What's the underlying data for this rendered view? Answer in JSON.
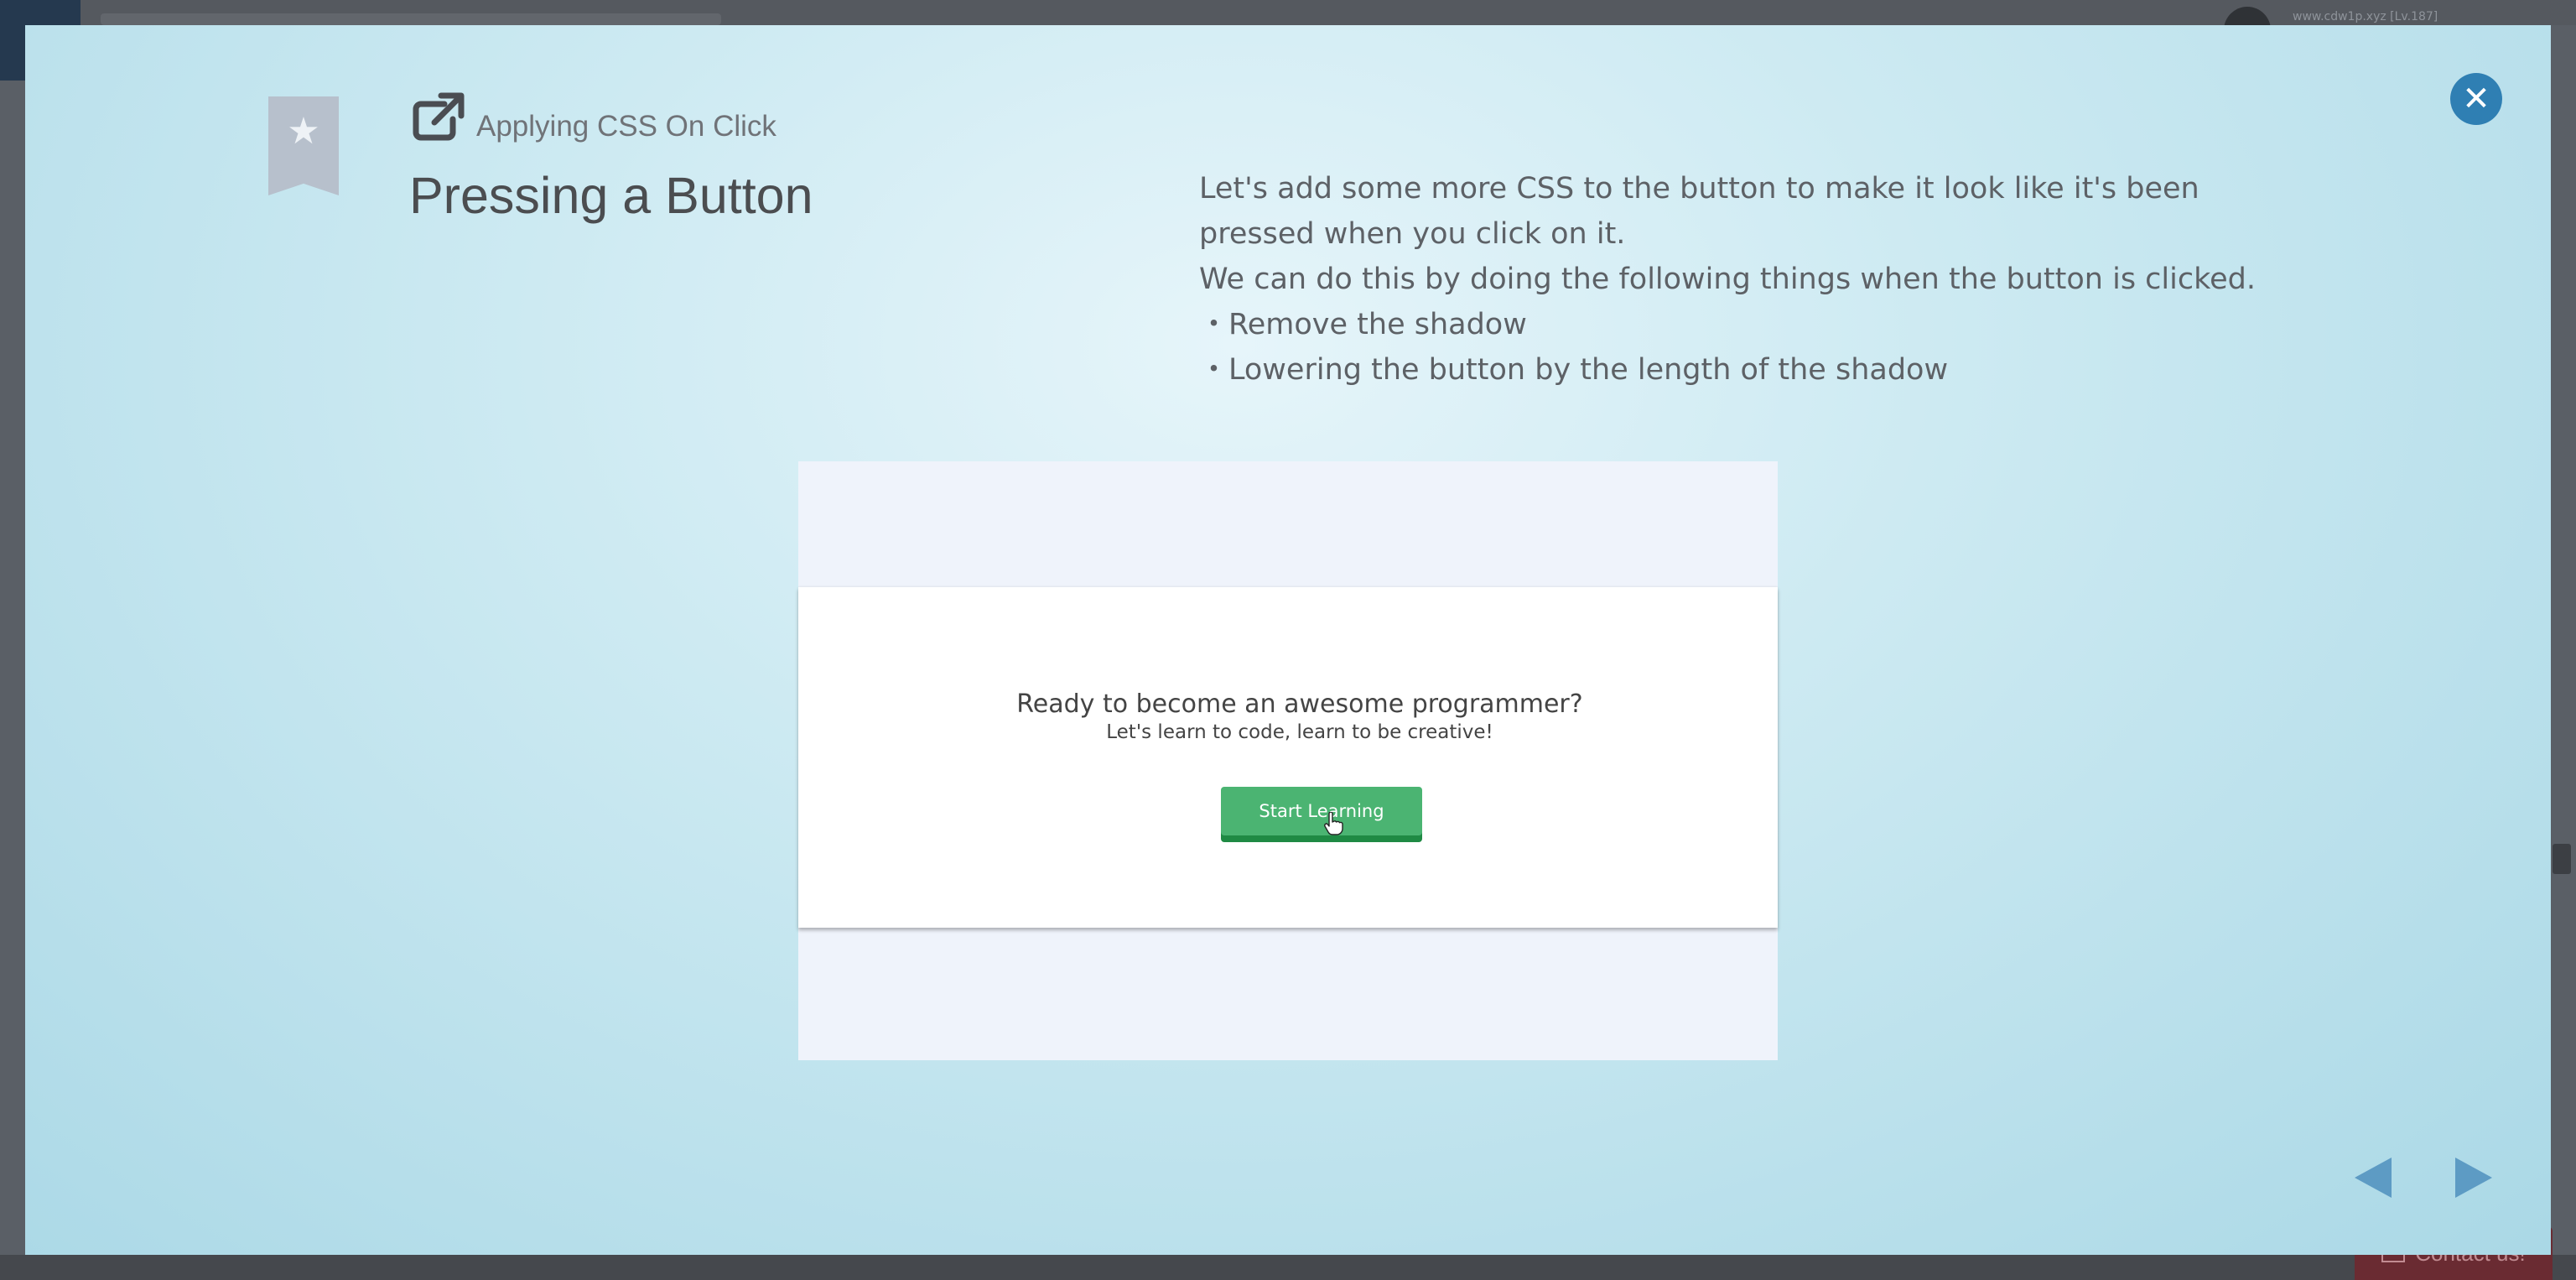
{
  "background": {
    "user_line": "www.cdw1p.xyz [Lv.187]",
    "contact_label": "Contact us!"
  },
  "modal": {
    "bookmark_icon": "star-icon",
    "subtitle": "Applying CSS On Click",
    "title": "Pressing a Button",
    "description": [
      "Let's add some more CSS to the button to make it look like it's been pressed when you click on it.",
      "We can do this by doing the following things when the button is clicked.",
      "・Remove the shadow",
      "・Lowering the button by the length of the shadow"
    ],
    "close_icon": "close-icon",
    "demo": {
      "heading": "Ready to become an awesome programmer?",
      "subheading": "Let's learn to code, learn to be creative!",
      "button_label": "Start Learning"
    },
    "nav": {
      "prev_icon": "triangle-left-icon",
      "next_icon": "triangle-right-icon"
    }
  },
  "colors": {
    "accent": "#2f7fb3",
    "button_green": "#4bb472",
    "button_shadow": "#1f8a44",
    "nav_arrow": "#5d9bc4"
  }
}
